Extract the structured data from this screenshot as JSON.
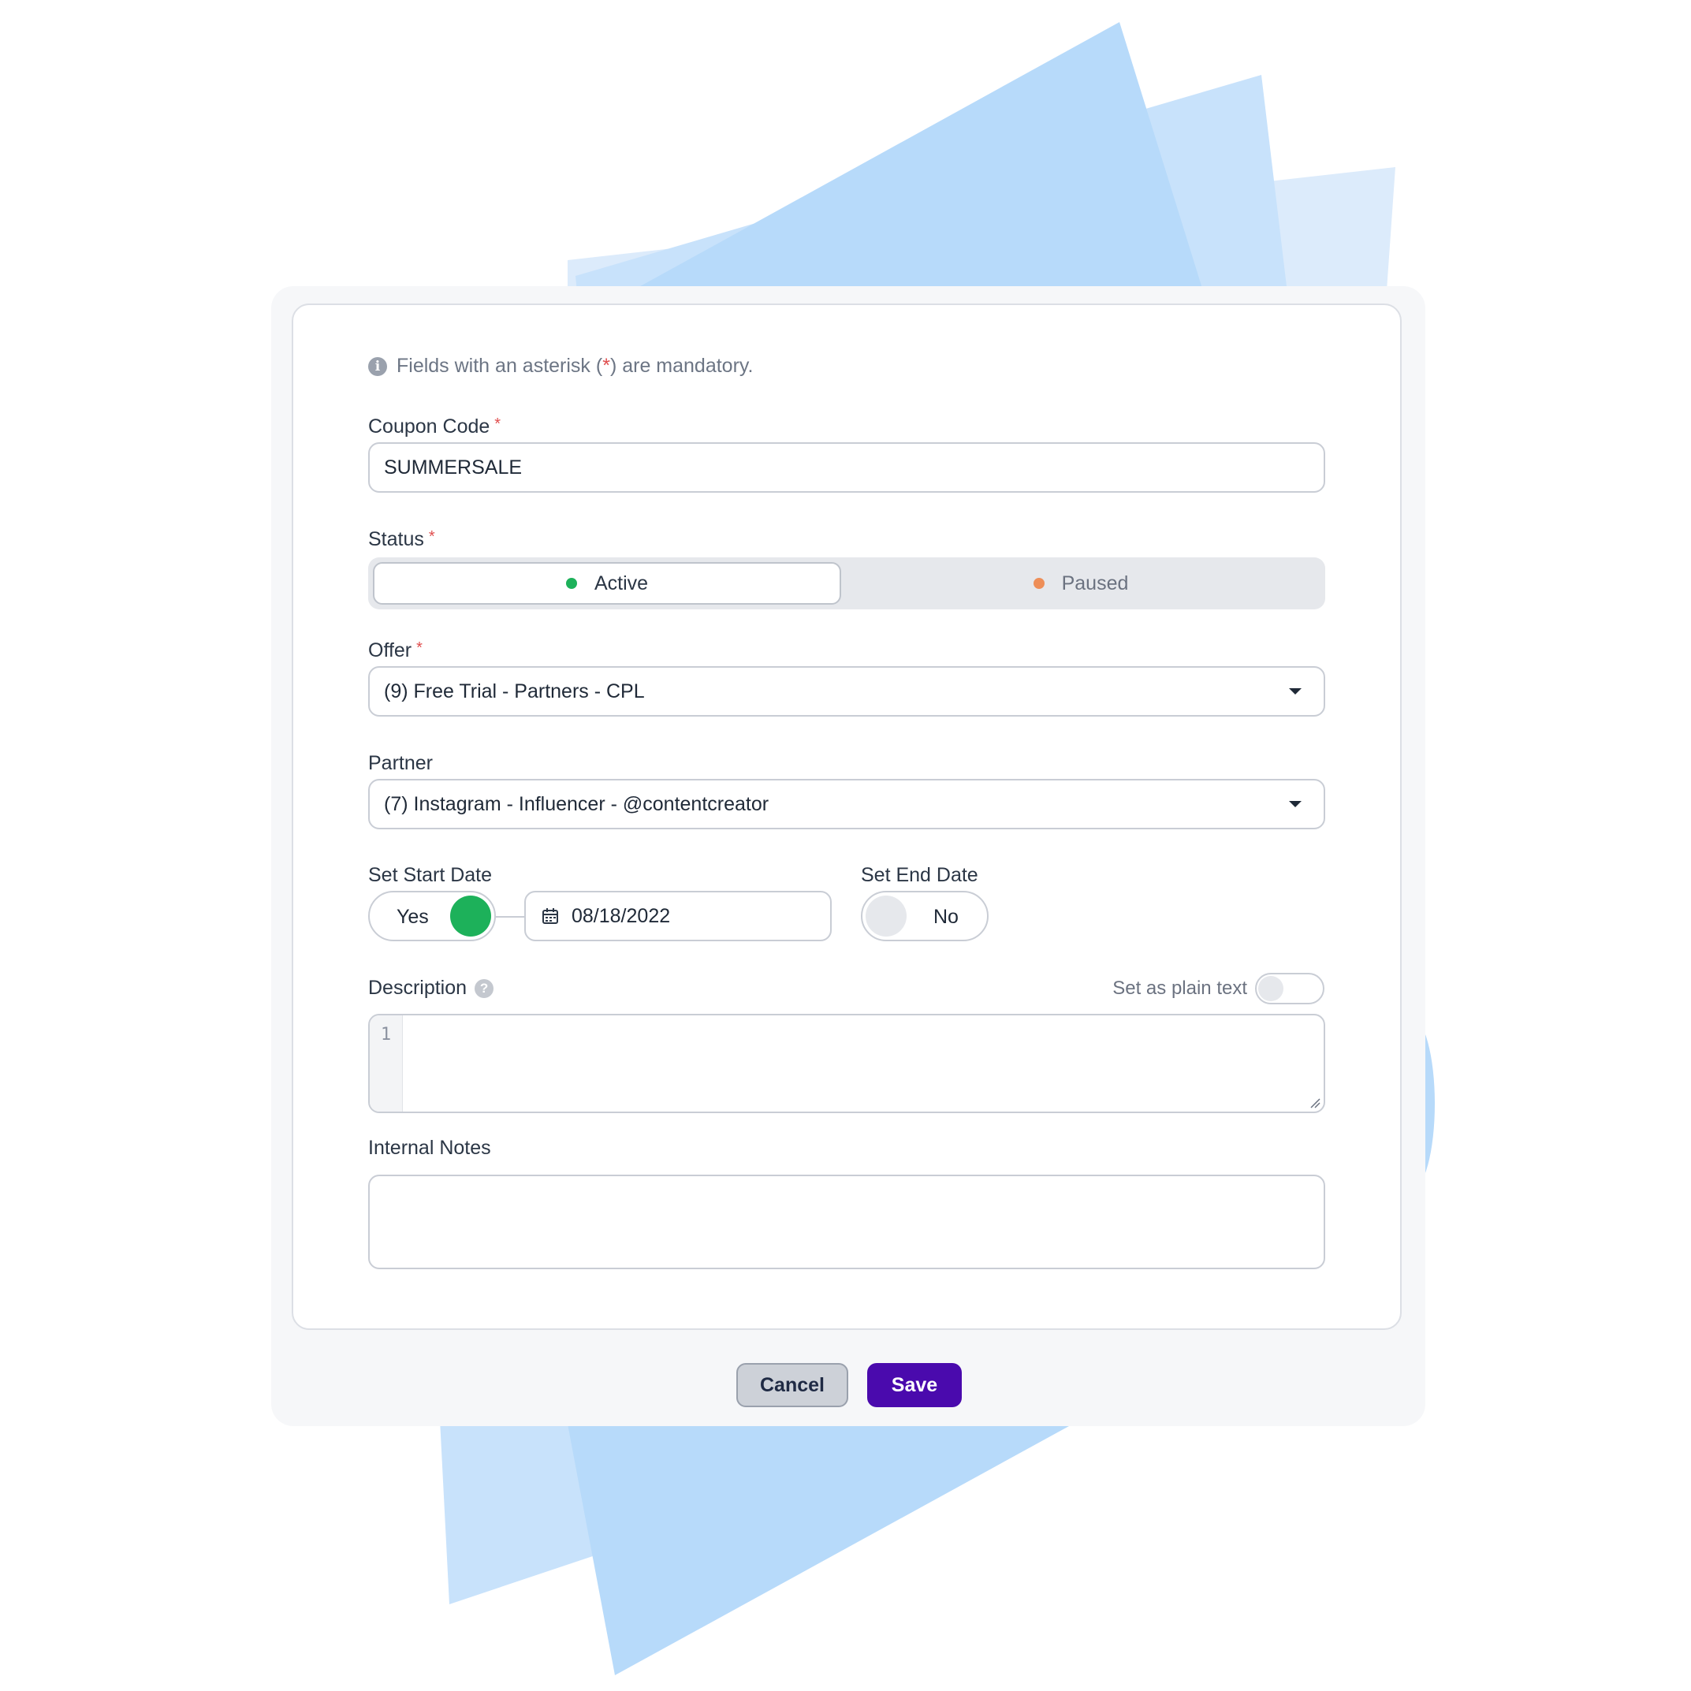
{
  "form": {
    "mandatory_note_prefix": "Fields with an asterisk (",
    "mandatory_note_star": "*",
    "mandatory_note_suffix": ") are mandatory.",
    "required_marker": "*",
    "coupon_code": {
      "label": "Coupon Code",
      "value": "SUMMERSALE"
    },
    "status": {
      "label": "Status",
      "options": [
        {
          "label": "Active",
          "color": "#1db15a",
          "selected": true
        },
        {
          "label": "Paused",
          "color": "#ee8e58",
          "selected": false
        }
      ]
    },
    "offer": {
      "label": "Offer",
      "value": "(9) Free Trial - Partners - CPL"
    },
    "partner": {
      "label": "Partner",
      "value": "(7) Instagram - Influencer - @contentcreator"
    },
    "start_date": {
      "label": "Set Start Date",
      "toggle_label": "Yes",
      "toggle_on": true,
      "date": "08/18/2022"
    },
    "end_date": {
      "label": "Set End Date",
      "toggle_label": "No",
      "toggle_on": false
    },
    "description": {
      "label": "Description",
      "help_icon": "question-icon",
      "plain_text_label": "Set as plain text",
      "line_number": "1",
      "value": ""
    },
    "internal_notes": {
      "label": "Internal Notes",
      "value": ""
    }
  },
  "actions": {
    "cancel_label": "Cancel",
    "save_label": "Save"
  },
  "colors": {
    "accent": "#4a0aad",
    "toggle_on": "#1db15a",
    "required": "#e04e4e"
  }
}
